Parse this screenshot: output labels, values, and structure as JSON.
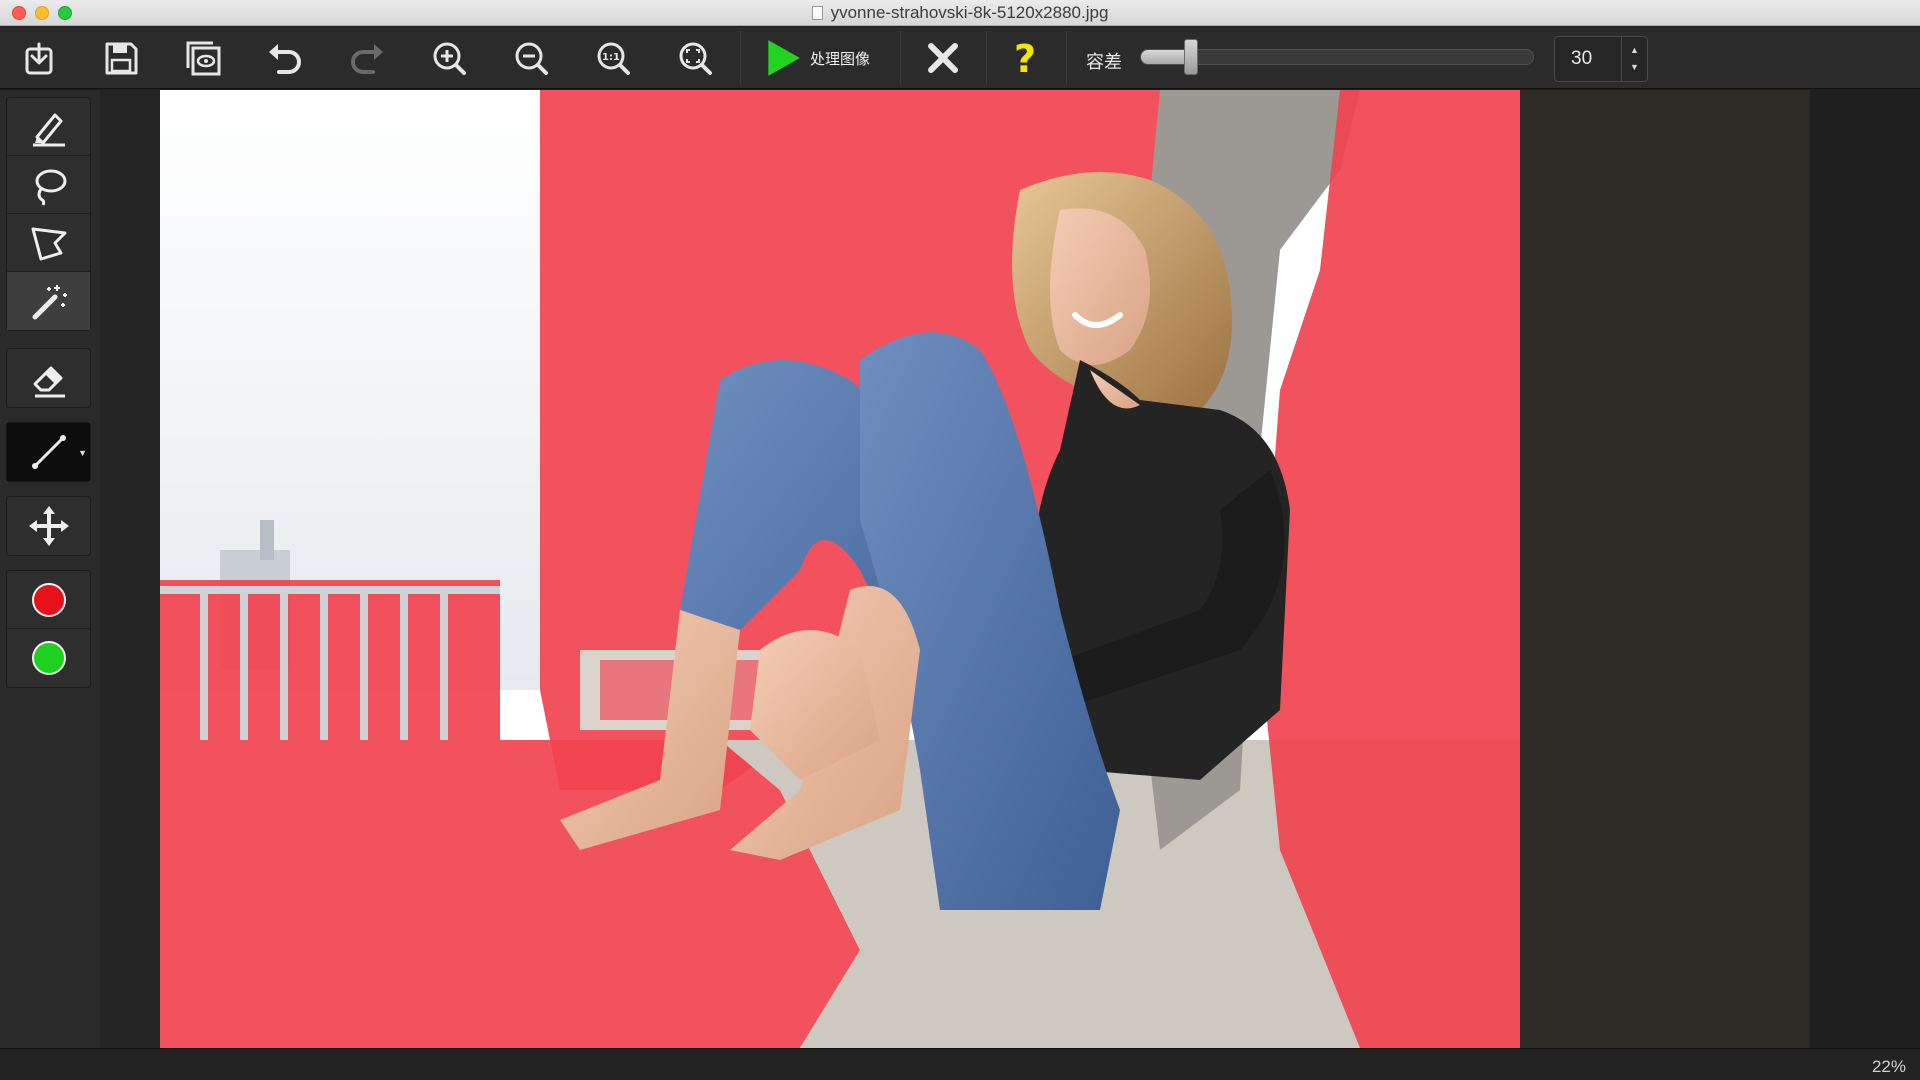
{
  "window": {
    "title": "yvonne-strahovski-8k-5120x2880.jpg"
  },
  "toolbar": {
    "process_label": "处理图像",
    "tolerance_label": "容差",
    "tolerance_value": "30",
    "tolerance_fraction": 0.13,
    "buttons": [
      "import-icon",
      "save-icon",
      "preview-icon",
      "undo-icon",
      "redo-icon",
      "zoom-in-icon",
      "zoom-out-icon",
      "zoom-actual-icon",
      "zoom-fit-icon",
      "play-icon",
      "close-x-icon",
      "help-question-icon"
    ]
  },
  "tools": {
    "selection": [
      "marker-pen-icon",
      "lasso-icon",
      "polygon-lasso-icon",
      "magic-wand-icon"
    ],
    "eraser": "eraser-icon",
    "line": "line-brush-icon",
    "move": "move-arrows-icon",
    "colors": {
      "remove": "#e8101a",
      "keep": "#1fd11f"
    }
  },
  "canvas": {
    "overlay_color": "#f1434f",
    "photo_subject": "woman in black top and blue jeans sitting against a wall"
  },
  "status": {
    "zoom": "22%"
  }
}
